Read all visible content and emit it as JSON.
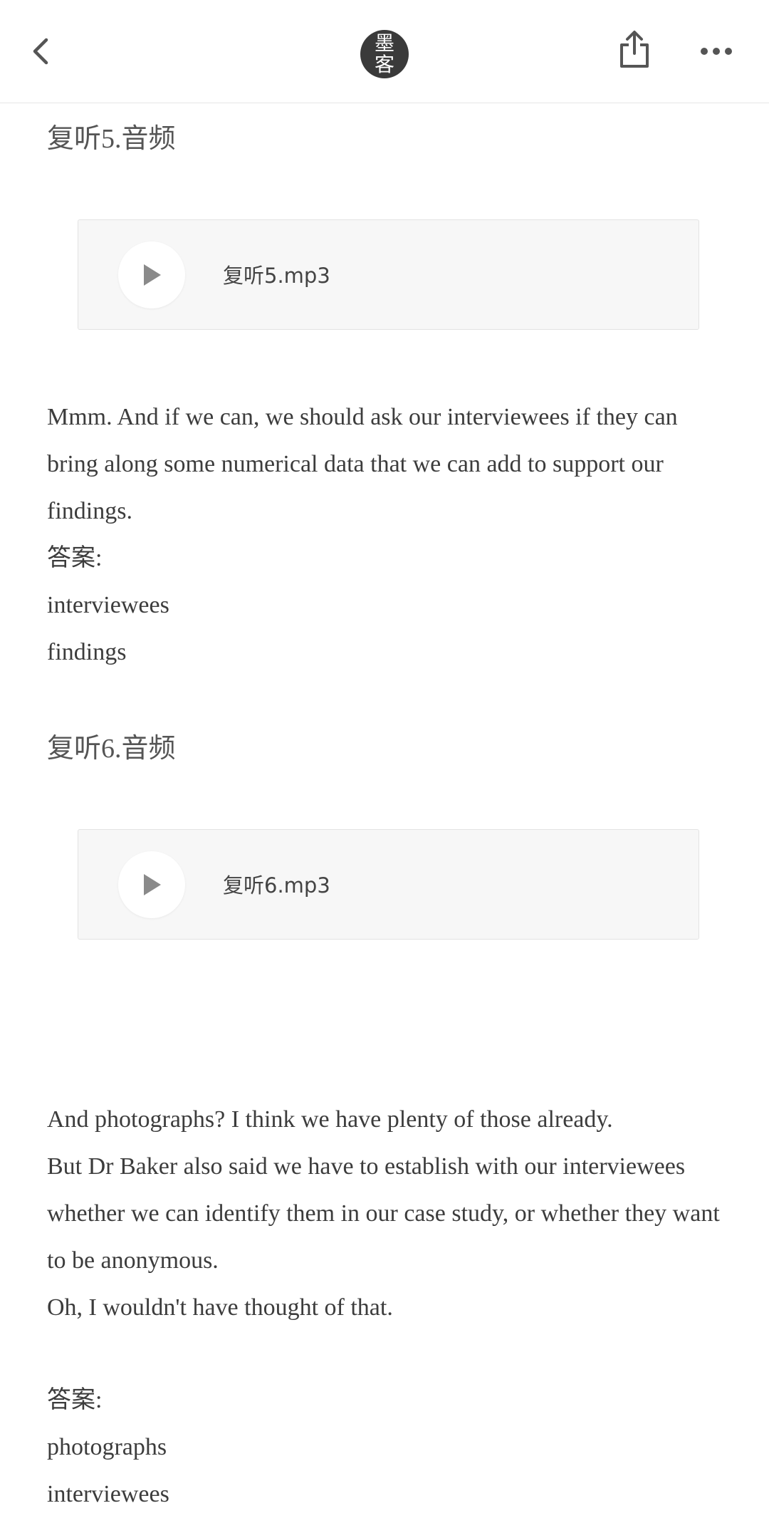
{
  "header": {
    "logo_top": "墨",
    "logo_bottom": "客"
  },
  "sections": [
    {
      "heading": "复听5.音频",
      "audio_name": "复听5.mp3",
      "paragraphs": [
        "Mmm. And if we can, we should ask our interviewees if they can bring along some numerical data that we can add to support our findings.",
        "答案:",
        "interviewees",
        "findings"
      ]
    },
    {
      "heading": "复听6.音频",
      "audio_name": "复听6.mp3",
      "paragraphs": [
        "And photographs? I think we have plenty of those already.",
        "But Dr Baker also said we have to establish with our interviewees whether we can identify them in our case study, or whether they want to be anonymous.",
        "Oh, I wouldn't have thought of that."
      ],
      "answer": [
        "答案:",
        "photographs",
        "interviewees"
      ]
    }
  ],
  "icons": {
    "back": "chevron-left-icon",
    "share": "share-icon",
    "more": "more-icon",
    "play": "play-icon"
  },
  "colors": {
    "text": "#3c3c3c",
    "card_bg": "#f7f7f7",
    "logo_bg": "#3a3a3a",
    "play_icon": "#8a8a8a"
  }
}
